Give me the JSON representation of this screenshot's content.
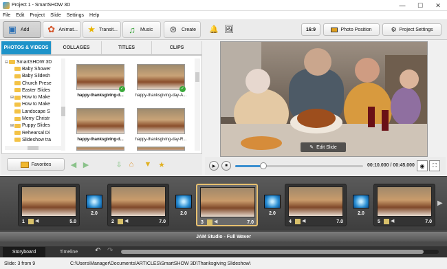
{
  "window": {
    "title": "Project 1 - SmartSHOW 3D"
  },
  "menu": [
    "File",
    "Edit",
    "Project",
    "Slide",
    "Settings",
    "Help"
  ],
  "toolbar": {
    "add": "Add",
    "animate": "Animat...",
    "transitions": "Transit...",
    "music": "Music",
    "create": "Create",
    "aspect": "16:9",
    "photo_position": "Photo Position",
    "project_settings": "Project Settings"
  },
  "tabs": [
    "PHOTOS & VIDEOS",
    "COLLAGES",
    "TITLES",
    "CLIPS"
  ],
  "tree": [
    {
      "label": "SmartSHOW 3D",
      "level": 0,
      "exp": "⊟"
    },
    {
      "label": "Baby Shower",
      "level": 1,
      "exp": ""
    },
    {
      "label": "Baby Slidesh",
      "level": 1,
      "exp": ""
    },
    {
      "label": "Church Prese",
      "level": 1,
      "exp": ""
    },
    {
      "label": "Easter Slides",
      "level": 1,
      "exp": ""
    },
    {
      "label": "How to Make",
      "level": 1,
      "exp": "⊞"
    },
    {
      "label": "How to Make",
      "level": 1,
      "exp": ""
    },
    {
      "label": "Landscape S",
      "level": 1,
      "exp": ""
    },
    {
      "label": "Merry Christr",
      "level": 1,
      "exp": ""
    },
    {
      "label": "Puppy Slides",
      "level": 1,
      "exp": "⊞"
    },
    {
      "label": "Rehearsal Di",
      "level": 1,
      "exp": ""
    },
    {
      "label": "Slideshow tra",
      "level": 1,
      "exp": ""
    }
  ],
  "thumbnails": [
    {
      "caption": "happy-thanksgiving-d...",
      "bold": true,
      "check": true
    },
    {
      "caption": "happy-thanksgiving-day-A...",
      "bold": false,
      "check": true
    },
    {
      "caption": "happy-thanksgiving-d...",
      "bold": true,
      "check": false
    },
    {
      "caption": "happy-thanksgiving-day-R...",
      "bold": false,
      "check": false
    }
  ],
  "favorites": "Favorites",
  "preview": {
    "edit_slide": "Edit Slide"
  },
  "player": {
    "time": "00:10.000 / 00:45.000",
    "progress": 0.22
  },
  "storyboard": {
    "slides": [
      {
        "num": "1",
        "duration": "5.0",
        "selected": false
      },
      {
        "num": "2",
        "duration": "7.0",
        "selected": false
      },
      {
        "num": "3",
        "duration": "7.0",
        "selected": true
      },
      {
        "num": "4",
        "duration": "7.0",
        "selected": false
      },
      {
        "num": "5",
        "duration": "7.0",
        "selected": false
      }
    ],
    "transitions": [
      "2.0",
      "2.0",
      "2.0",
      "2.0"
    ],
    "music_track": "JAM Studio - Full Waver"
  },
  "bottom_tabs": {
    "storyboard": "Storyboard",
    "timeline": "Timeline"
  },
  "status": {
    "slide_counter": "Slide: 3 from 9",
    "path": "C:\\Users\\Manager\\Documents\\ARTICLES\\SmartSHOW 3D\\Thanksgiving Slideshow\\"
  }
}
